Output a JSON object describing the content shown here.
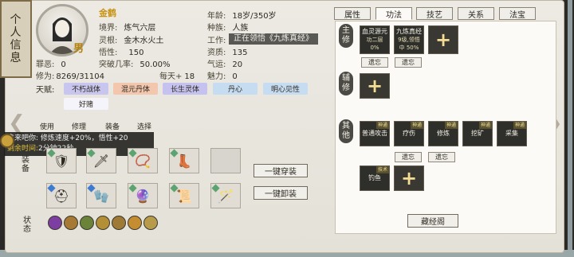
{
  "window": {
    "title_chars": [
      "个",
      "人",
      "信",
      "息"
    ]
  },
  "character": {
    "name": "金鹤",
    "gender": "男",
    "realm_label": "境界:",
    "realm": "炼气六层",
    "root_label": "灵根:",
    "root": "金木水火土",
    "comprehension_label": "悟性:",
    "comprehension": "150",
    "breakthrough_label": "突破几率:",
    "breakthrough": "50.00%",
    "sin_label": "罪恶:",
    "sin": "0",
    "cultivation_label": "修为:",
    "cultivation": "8269/31104",
    "per_day_label": "每天+",
    "per_day": "18",
    "age_label": "年龄:",
    "age": "18岁/350岁",
    "race_label": "种族:",
    "race": "人族",
    "work_label": "工作:",
    "aptitude_label": "资质:",
    "aptitude": "135",
    "luck_label": "气运:",
    "luck": "20",
    "charm_label": "魅力:",
    "charm": "0",
    "talent_label": "天赋:"
  },
  "talents": [
    {
      "label": "不朽战体",
      "color": "#c8c6ee"
    },
    {
      "label": "混元丹体",
      "color": "#f3c7ad"
    },
    {
      "label": "长生灵体",
      "color": "#c5c2ef"
    },
    {
      "label": "丹心",
      "color": "#c6dcf0"
    },
    {
      "label": "明心见性",
      "color": "#c6dcf0"
    },
    {
      "label": "好赌",
      "color": "#f6f4fb"
    }
  ],
  "tabs": [
    "属性",
    "功法",
    "技艺",
    "关系",
    "法宝"
  ],
  "active_tab": "功法",
  "sections": {
    "main": "主修",
    "aux": "辅修",
    "other": "其他"
  },
  "main_skills": [
    {
      "title": "血灵源元",
      "sub": "功二层",
      "pct": "0%",
      "badge": ""
    },
    {
      "title": "九炼真经",
      "sub": "9级,领悟",
      "pct": "中 50%",
      "badge": ""
    }
  ],
  "other_skills": [
    {
      "title": "普通攻击",
      "badge": "神通"
    },
    {
      "title": "疗伤",
      "badge": "神通"
    },
    {
      "title": "修炼",
      "badge": "神通"
    },
    {
      "title": "挖矿",
      "badge": "神通"
    },
    {
      "title": "采集",
      "badge": "神通"
    },
    {
      "title": "钓鱼",
      "badge": "技术"
    }
  ],
  "forget_label": "遗忘",
  "overlay_text": "正在领悟《九炼真经》",
  "library_button": "藏经阁",
  "equip_tabs": [
    "使用",
    "修理",
    "装备",
    "选择"
  ],
  "equip_label": "装备",
  "status_label": "状态",
  "one_key_wear": "一键穿装",
  "one_key_remove": "一键卸装",
  "tooltip": {
    "line1": "拿来吧你: 修炼速度+20%，悟性+20",
    "remain_label": "剩余时间:",
    "remain_value": "2分钟22秒"
  },
  "colors": {
    "gold": "#c89312",
    "panel": "#e8e5dd"
  }
}
